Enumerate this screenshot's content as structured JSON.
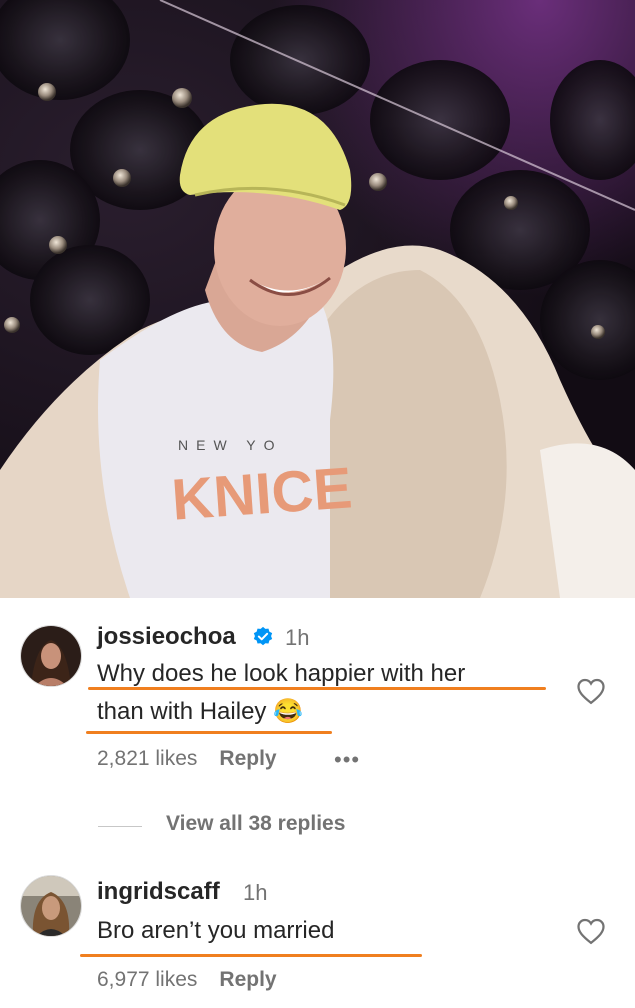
{
  "comments": [
    {
      "username": "jossieochoa",
      "verified": true,
      "time": "1h",
      "text_line1": "Why does he look happier with her",
      "text_line2": "than with Hailey",
      "emoji": "😂",
      "likes": "2,821 likes",
      "reply_label": "Reply",
      "more_label": "•••"
    },
    {
      "username": "ingridscaff",
      "verified": false,
      "time": "1h",
      "text_line1": "Bro aren’t you married",
      "likes": "6,977 likes",
      "reply_label": "Reply"
    }
  ],
  "view_replies": "View all 38 replies",
  "colors": {
    "underline": "#f07f1f",
    "verified": "#0095f6",
    "muted": "#737373",
    "text": "#262626"
  }
}
